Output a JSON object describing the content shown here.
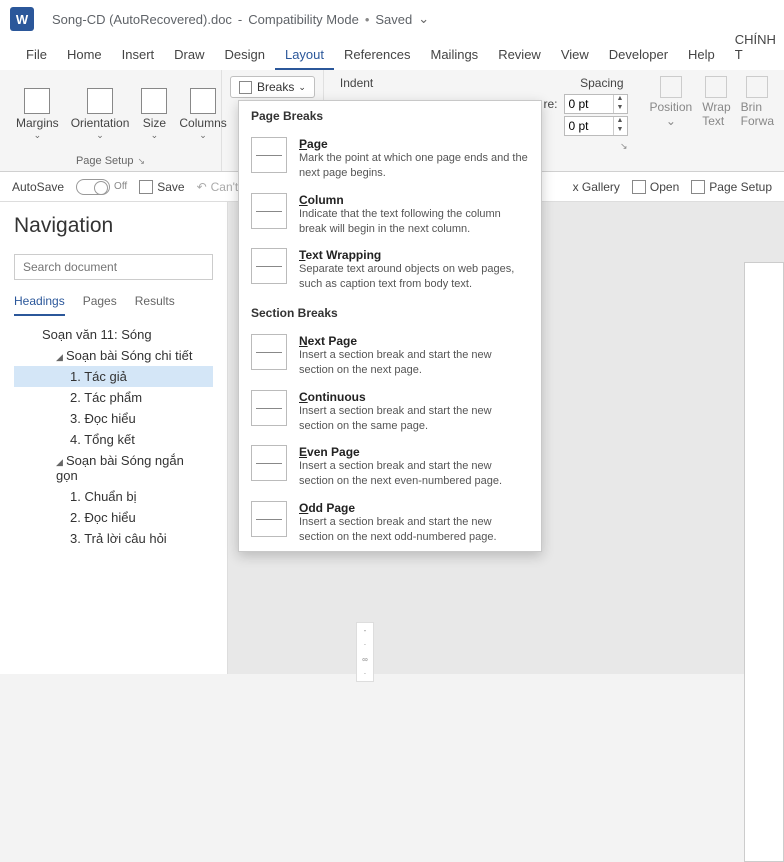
{
  "title": {
    "filename": "Song-CD (AutoRecovered).doc",
    "mode": "Compatibility Mode",
    "saved": "Saved"
  },
  "tabs": [
    "File",
    "Home",
    "Insert",
    "Draw",
    "Design",
    "Layout",
    "References",
    "Mailings",
    "Review",
    "View",
    "Developer",
    "Help",
    "CHÍNH T"
  ],
  "activeTab": "Layout",
  "ribbon": {
    "margins": "Margins",
    "orientation": "Orientation",
    "size": "Size",
    "columns": "Columns",
    "pageSetup": "Page Setup",
    "breaks": "Breaks",
    "indent": "Indent",
    "spacing": "Spacing",
    "beforeLabel": "re:",
    "before": "0 pt",
    "after": "0 pt",
    "position": "Position",
    "wrapText": "Wrap\nText",
    "bring": "Brin\nForwa"
  },
  "qbar": {
    "autosave": "AutoSave",
    "off": "Off",
    "save": "Save",
    "cant": "Can't",
    "gallery": "x Gallery",
    "open": "Open",
    "pageSetup": "Page Setup"
  },
  "nav": {
    "title": "Navigation",
    "searchPlaceholder": "Search document",
    "tabs": [
      "Headings",
      "Pages",
      "Results"
    ],
    "activeTab": "Headings",
    "tree": [
      {
        "lvl": 1,
        "label": "Soạn văn 11: Sóng",
        "exp": false
      },
      {
        "lvl": 2,
        "label": "Soạn bài Sóng chi tiết",
        "exp": true
      },
      {
        "lvl": 3,
        "label": "1. Tác giả",
        "sel": true
      },
      {
        "lvl": 3,
        "label": "2. Tác phẩm"
      },
      {
        "lvl": 3,
        "label": "3. Đọc hiểu"
      },
      {
        "lvl": 3,
        "label": "4. Tổng kết"
      },
      {
        "lvl": 2,
        "label": "Soạn bài Sóng ngắn gọn",
        "exp": true
      },
      {
        "lvl": 3,
        "label": "1. Chuẩn bị"
      },
      {
        "lvl": 3,
        "label": "2. Đọc hiểu"
      },
      {
        "lvl": 3,
        "label": "3. Trả lời câu hỏi"
      }
    ]
  },
  "dropdown": {
    "sec1": "Page Breaks",
    "sec2": "Section Breaks",
    "items": [
      {
        "t": "Page",
        "d": "Mark the point at which one page ends and the next page begins."
      },
      {
        "t": "Column",
        "d": "Indicate that the text following the column break will begin in the next column."
      },
      {
        "t": "Text Wrapping",
        "d": "Separate text around objects on web pages, such as caption text from body text."
      },
      {
        "t": "Next Page",
        "d": "Insert a section break and start the new section on the next page."
      },
      {
        "t": "Continuous",
        "d": "Insert a section break and start the new section on the same page."
      },
      {
        "t": "Even Page",
        "d": "Insert a section break and start the new section on the next even-numbered page."
      },
      {
        "t": "Odd Page",
        "d": "Insert a section break and start the new section on the next odd-numbered page."
      }
    ]
  }
}
